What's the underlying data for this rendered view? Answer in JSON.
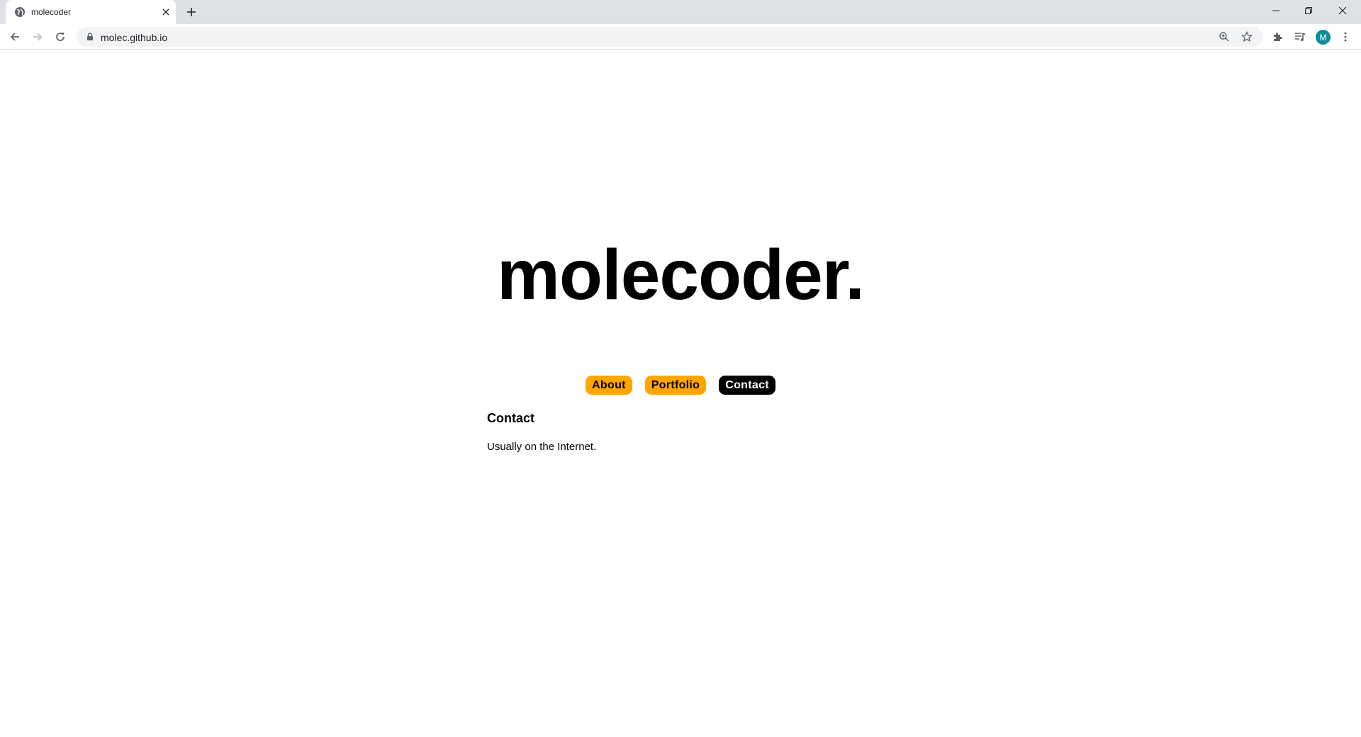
{
  "browser": {
    "tab_title": "molecoder",
    "url": "molec.github.io",
    "profile_initial": "M",
    "accent_color": "#0f8b9a"
  },
  "icons": {
    "favicon": "globe-icon",
    "tab_close": "close-icon",
    "new_tab": "plus-icon",
    "minimize": "minimize-icon",
    "restore": "restore-icon",
    "close_window": "close-icon",
    "back": "arrow-left-icon",
    "forward": "arrow-right-icon",
    "reload": "reload-icon",
    "lock": "lock-icon",
    "zoom": "zoom-icon",
    "bookmark": "star-icon",
    "extensions": "puzzle-icon",
    "media": "media-queue-icon",
    "menu": "kebab-menu-icon"
  },
  "site": {
    "title": "molecoder.",
    "nav": {
      "about": "About",
      "portfolio": "Portfolio",
      "contact": "Contact"
    },
    "colors": {
      "pill": "#ffa500",
      "active_pill": "#000000"
    },
    "section": {
      "heading": "Contact",
      "text": "Usually on the Internet."
    }
  }
}
